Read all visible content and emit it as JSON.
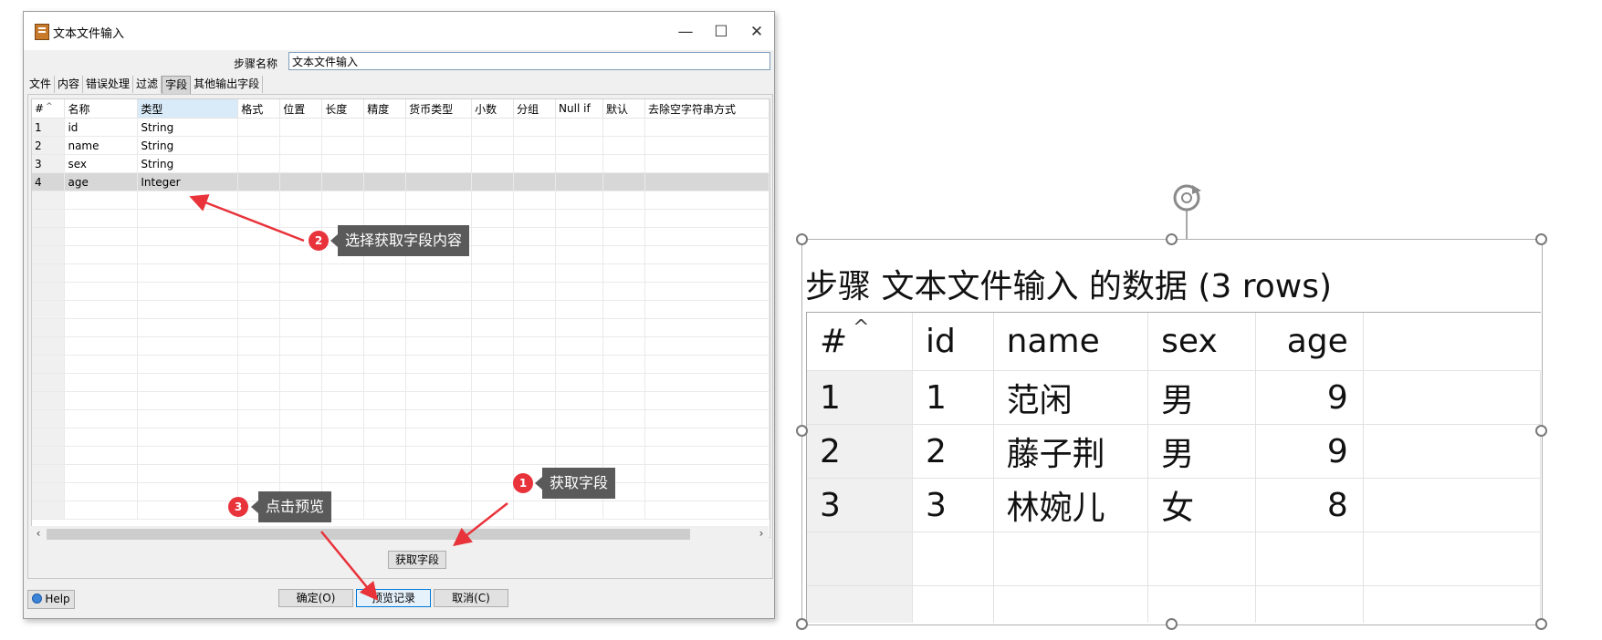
{
  "dialog": {
    "title": "文本文件输入",
    "minimize_icon": "minimize-icon",
    "maximize_icon": "maximize-icon",
    "close_icon": "close-icon",
    "step_name_label": "步骤名称",
    "step_name_value": "文本文件输入",
    "tabs": [
      "文件",
      "内容",
      "错误处理",
      "过滤",
      "字段",
      "其他输出字段"
    ],
    "active_tab": "字段",
    "columns": [
      "#",
      "名称",
      "类型",
      "格式",
      "位置",
      "长度",
      "精度",
      "货币类型",
      "小数",
      "分组",
      "Null if",
      "默认",
      "去除空字符串方式"
    ],
    "rows": [
      [
        "1",
        "id",
        "String"
      ],
      [
        "2",
        "name",
        "String"
      ],
      [
        "3",
        "sex",
        "String"
      ],
      [
        "4",
        "age",
        "Integer"
      ]
    ],
    "selected_row": 4,
    "get_fields_label": "获取字段",
    "help_label": "Help",
    "ok_label": "确定(O)",
    "preview_label": "预览记录",
    "cancel_label": "取消(C)",
    "scroll_left": "‹",
    "scroll_right": "›"
  },
  "callouts": [
    {
      "number": "1",
      "text": "获取字段"
    },
    {
      "number": "2",
      "text": "选择获取字段内容"
    },
    {
      "number": "3",
      "text": "点击预览"
    }
  ],
  "preview": {
    "title": "步骤 文本文件输入 的数据 (3 rows)",
    "columns": [
      "#",
      "id",
      "name",
      "sex",
      "age"
    ],
    "rows": [
      [
        "1",
        "1",
        "范闲",
        "男",
        "9"
      ],
      [
        "2",
        "2",
        "藤子荆",
        "男",
        "9"
      ],
      [
        "3",
        "3",
        "林婉儿",
        "女",
        "8"
      ]
    ],
    "rotate_icon": "rotate-icon"
  },
  "colors": {
    "callout_badge": "#e8333b",
    "callout_bg": "#5a5a5a",
    "arrow": "#e8333b",
    "selected_row": "#d7d7d7"
  }
}
